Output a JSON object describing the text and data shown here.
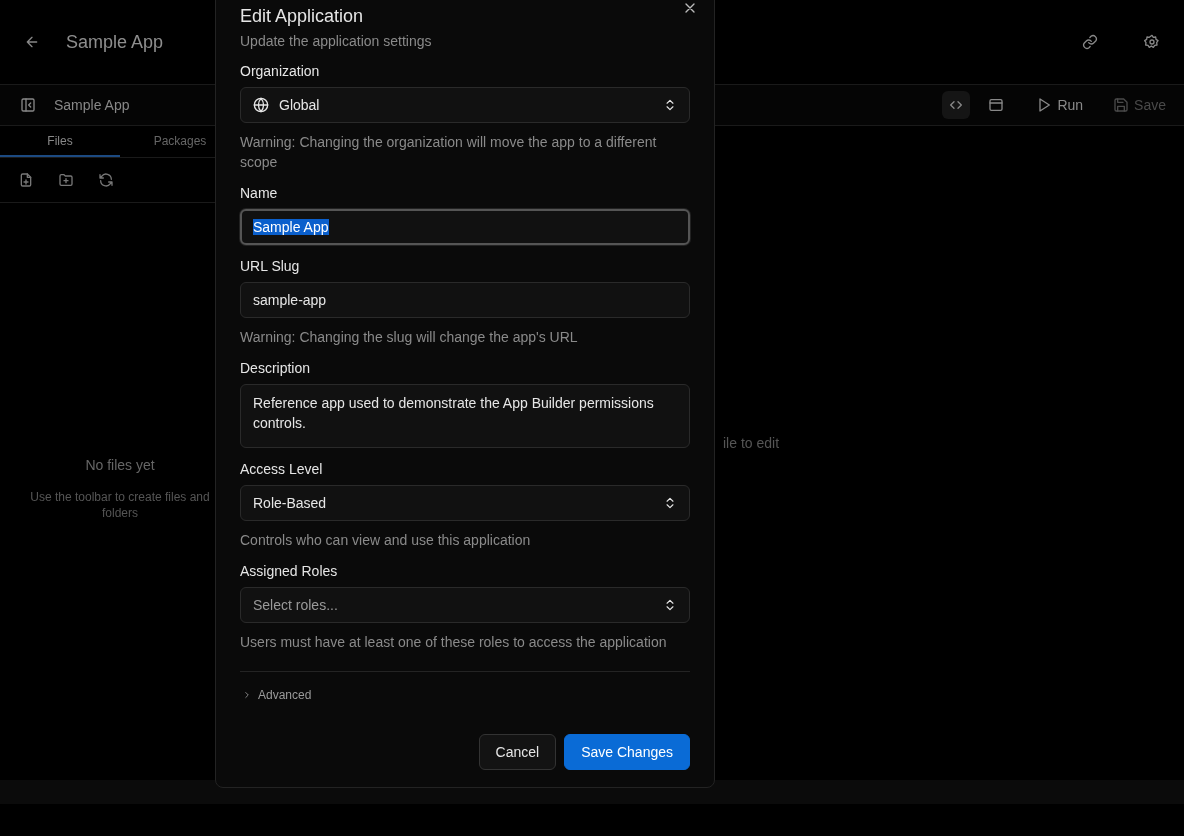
{
  "header": {
    "title": "Sample App"
  },
  "toolbar": {
    "project": "Sample App",
    "views": [
      {
        "kind": "code",
        "selected": true
      },
      {
        "kind": "preview",
        "selected": false
      }
    ],
    "actions": [
      {
        "kind": "run",
        "label": "Run",
        "disabled": false
      },
      {
        "kind": "save",
        "label": "Save",
        "disabled": true
      }
    ]
  },
  "sidebar": {
    "tabs": [
      {
        "label": "Files",
        "selected": true
      },
      {
        "label": "Packages",
        "selected": false
      }
    ],
    "empty_title": "No files yet",
    "empty_hint": "Use the toolbar to create files and folders"
  },
  "editor": {
    "hint": "ile to edit"
  },
  "dialog": {
    "title": "Edit Application",
    "subtitle": "Update the application settings",
    "fields": [
      {
        "kind": "select",
        "label": "Organization",
        "value": "Global",
        "help": "Warning: Changing the organization will move the app to a different scope"
      },
      {
        "kind": "text",
        "label": "Name",
        "value": "Sample App",
        "focused": true,
        "text_selected": true
      },
      {
        "kind": "text",
        "label": "URL Slug",
        "value": "sample-app",
        "focused": false,
        "text_selected": false,
        "help": "Warning: Changing the slug will change the app's URL"
      },
      {
        "kind": "textarea",
        "label": "Description",
        "value": "Reference app used to demonstrate the App Builder permissions controls."
      },
      {
        "kind": "select",
        "label": "Access Level",
        "value": "Role-Based",
        "help": "Controls who can view and use this application"
      },
      {
        "kind": "select",
        "label": "Assigned Roles",
        "placeholder": "Select roles...",
        "help": "Users must have at least one of these roles to access the application"
      }
    ],
    "advanced": {
      "label": "Advanced",
      "expanded": false
    },
    "buttons": [
      {
        "kind": "secondary",
        "label": "Cancel"
      },
      {
        "kind": "primary",
        "label": "Save Changes"
      }
    ]
  }
}
